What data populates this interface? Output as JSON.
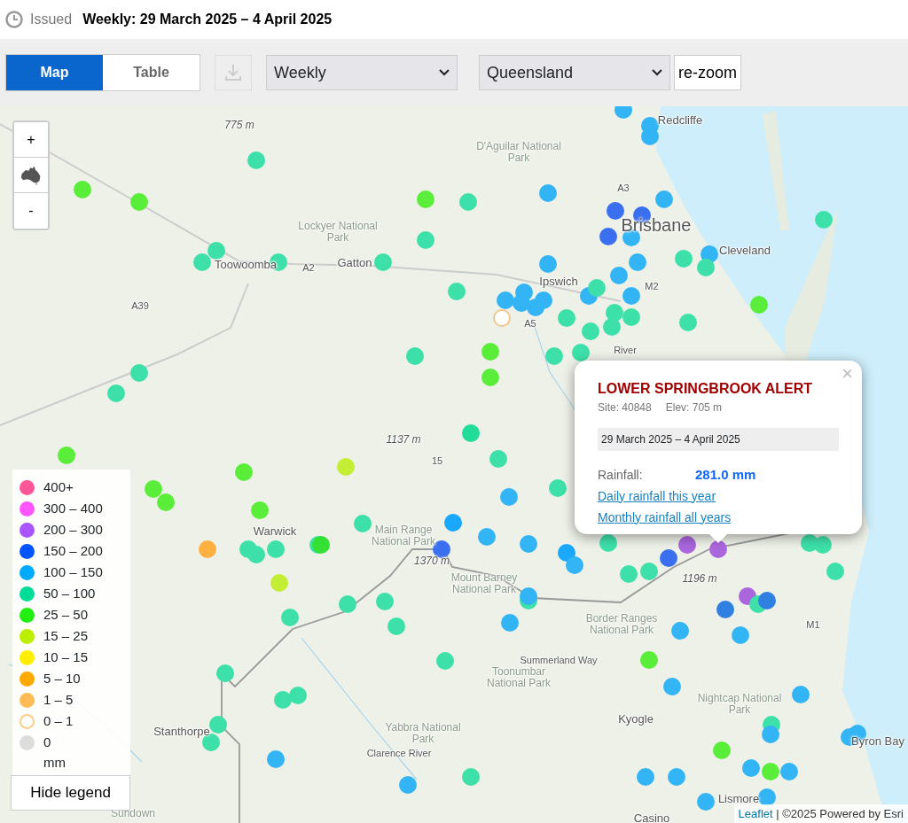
{
  "header": {
    "issued_label": "Issued",
    "title": "Weekly: 29 March 2025 – 4 April 2025"
  },
  "toolbar": {
    "tabs": [
      {
        "label": "Map",
        "selected": true
      },
      {
        "label": "Table",
        "selected": false
      }
    ],
    "download": {
      "disabled": true
    },
    "period_select": {
      "value": "Weekly"
    },
    "region_select": {
      "value": "Queensland"
    },
    "rezoom_button": {
      "label": "re-zoom"
    }
  },
  "map": {
    "zoom_controls": {
      "zoom_in": "+",
      "zoom_out": "-"
    },
    "places": [
      {
        "name": "775 m",
        "kind": "elev"
      },
      {
        "name": "Redcliffe",
        "kind": "town"
      },
      {
        "name": "D'Aguilar National Park",
        "kind": "park"
      },
      {
        "name": "Lockyer National Park",
        "kind": "park"
      },
      {
        "name": "Brisbane",
        "kind": "city"
      },
      {
        "name": "Cleveland",
        "kind": "town"
      },
      {
        "name": "Toowoomba",
        "kind": "town"
      },
      {
        "name": "A2",
        "kind": "road"
      },
      {
        "name": "Gatton",
        "kind": "town"
      },
      {
        "name": "A39",
        "kind": "road"
      },
      {
        "name": "A3",
        "kind": "road"
      },
      {
        "name": "Ipswich",
        "kind": "town"
      },
      {
        "name": "M2",
        "kind": "road"
      },
      {
        "name": "A5",
        "kind": "road"
      },
      {
        "name": "River",
        "kind": "road"
      },
      {
        "name": "1137 m",
        "kind": "elev"
      },
      {
        "name": "15",
        "kind": "road"
      },
      {
        "name": "Warwick",
        "kind": "town"
      },
      {
        "name": "Main Range National Park",
        "kind": "park"
      },
      {
        "name": "1370 m",
        "kind": "elev"
      },
      {
        "name": "Mount Barney National Park",
        "kind": "park"
      },
      {
        "name": "1196 m",
        "kind": "elev"
      },
      {
        "name": "Border Ranges National Park",
        "kind": "park"
      },
      {
        "name": "Summerland Way",
        "kind": "road"
      },
      {
        "name": "Toonumbar National Park",
        "kind": "park"
      },
      {
        "name": "Kyogle",
        "kind": "town"
      },
      {
        "name": "Nightcap National Park",
        "kind": "park"
      },
      {
        "name": "Yabbra National Park",
        "kind": "park"
      },
      {
        "name": "Clarence River",
        "kind": "road"
      },
      {
        "name": "Stanthorpe",
        "kind": "town"
      },
      {
        "name": "M1",
        "kind": "road"
      },
      {
        "name": "Byron Bay",
        "kind": "town"
      },
      {
        "name": "Lismore",
        "kind": "town"
      },
      {
        "name": "Casino",
        "kind": "town"
      },
      {
        "name": "Sundown",
        "kind": "park"
      }
    ],
    "stations": [
      {
        "color": "#33b5f5",
        "kind": "dot"
      },
      {
        "color": "#33b5f5",
        "kind": "dot"
      },
      {
        "color": "#33b5f5",
        "kind": "dot"
      },
      {
        "color": "#3ee0aa",
        "kind": "dot"
      },
      {
        "color": "#5aee3a",
        "kind": "dot"
      },
      {
        "color": "#5aee3a",
        "kind": "dot"
      },
      {
        "color": "#33b5f5",
        "kind": "dot"
      },
      {
        "color": "#3ee0aa",
        "kind": "dot"
      },
      {
        "color": "#5aee3a",
        "kind": "dot"
      },
      {
        "color": "#3a6ff0",
        "kind": "dot"
      },
      {
        "color": "#3a6ff0",
        "kind": "dot"
      },
      {
        "color": "#33b5f5",
        "kind": "dot"
      },
      {
        "color": "#3ee0aa",
        "kind": "dot"
      },
      {
        "color": "#3ee0aa",
        "kind": "dot"
      },
      {
        "color": "#3a6ff0",
        "kind": "dot"
      },
      {
        "color": "#33b5f5",
        "kind": "dot"
      },
      {
        "color": "#3ee0aa",
        "kind": "dot"
      },
      {
        "color": "#3ee0aa",
        "kind": "dot"
      },
      {
        "color": "#3ee0aa",
        "kind": "dot"
      },
      {
        "color": "#3ee0aa",
        "kind": "dot"
      },
      {
        "color": "#3ee0aa",
        "kind": "dot"
      },
      {
        "color": "#33b5f5",
        "kind": "dot"
      },
      {
        "color": "#3ee0aa",
        "kind": "dot"
      },
      {
        "color": "#33b5f5",
        "kind": "dot"
      },
      {
        "color": "#33b5f5",
        "kind": "dot"
      },
      {
        "color": "#33b5f5",
        "kind": "dot"
      },
      {
        "color": "#3ee0aa",
        "kind": "dot"
      },
      {
        "color": "#33b5f5",
        "kind": "dot"
      },
      {
        "color": "#33b5f5",
        "kind": "dot"
      },
      {
        "color": "#33b5f5",
        "kind": "dot"
      },
      {
        "color": "#33b5f5",
        "kind": "dot"
      },
      {
        "color": "#33b5f5",
        "kind": "dot"
      },
      {
        "color": "#33b5f5",
        "kind": "dot"
      },
      {
        "color": "#3ee0aa",
        "kind": "dot"
      },
      {
        "color": "#33b5f5",
        "kind": "dot"
      },
      {
        "color": "#5aee3a",
        "kind": "dot"
      },
      {
        "color": "#f0c890",
        "kind": "ring"
      },
      {
        "color": "#3ee0aa",
        "kind": "dot"
      },
      {
        "color": "#3ee0aa",
        "kind": "dot"
      },
      {
        "color": "#3ee0aa",
        "kind": "dot"
      },
      {
        "color": "#3ee0aa",
        "kind": "dot"
      },
      {
        "color": "#3ee0aa",
        "kind": "dot"
      },
      {
        "color": "#3ee0aa",
        "kind": "dot"
      },
      {
        "color": "#5aee3a",
        "kind": "dot"
      },
      {
        "color": "#3ee0aa",
        "kind": "dot"
      },
      {
        "color": "#3ee0aa",
        "kind": "dot"
      },
      {
        "color": "#3ee0aa",
        "kind": "dot"
      },
      {
        "color": "#3ee0aa",
        "kind": "dot"
      },
      {
        "color": "#5aee3a",
        "kind": "dot"
      },
      {
        "color": "#3ee0aa",
        "kind": "dot"
      },
      {
        "color": "#22dd99",
        "kind": "dot"
      },
      {
        "color": "#c4ee33",
        "kind": "dot"
      },
      {
        "color": "#5aee3a",
        "kind": "dot"
      },
      {
        "color": "#5aee3a",
        "kind": "dot"
      },
      {
        "color": "#3ee0aa",
        "kind": "dot"
      },
      {
        "color": "#3ee0aa",
        "kind": "dot"
      },
      {
        "color": "#5aee3a",
        "kind": "dot"
      },
      {
        "color": "#5aee3a",
        "kind": "dot"
      },
      {
        "color": "#5aee3a",
        "kind": "dot"
      },
      {
        "color": "#33b5f5",
        "kind": "dot"
      },
      {
        "color": "#ffb040",
        "kind": "dot"
      },
      {
        "color": "#3ee0aa",
        "kind": "dot"
      },
      {
        "color": "#3ee0aa",
        "kind": "dot"
      },
      {
        "color": "#3ee0aa",
        "kind": "dot"
      },
      {
        "color": "#3ee0aa",
        "kind": "dot"
      },
      {
        "color": "#33e033",
        "kind": "dot"
      },
      {
        "color": "#3ee0aa",
        "kind": "dot"
      },
      {
        "color": "#1aa8ff",
        "kind": "dot"
      },
      {
        "color": "#33b5f5",
        "kind": "dot"
      },
      {
        "color": "#33b5f5",
        "kind": "dot"
      },
      {
        "color": "#3a6ff0",
        "kind": "dot"
      },
      {
        "color": "#1aa8ff",
        "kind": "dot"
      },
      {
        "color": "#33b5f5",
        "kind": "dot"
      },
      {
        "color": "#c4ee33",
        "kind": "dot"
      },
      {
        "color": "#3ee0aa",
        "kind": "dot"
      },
      {
        "color": "#3ee0aa",
        "kind": "dot"
      },
      {
        "color": "#3ee0aa",
        "kind": "dot"
      },
      {
        "color": "#3ee0aa",
        "kind": "dot"
      },
      {
        "color": "#3ee0aa",
        "kind": "dot"
      },
      {
        "color": "#3ee0aa",
        "kind": "dot"
      },
      {
        "color": "#3ee0aa",
        "kind": "dot"
      },
      {
        "color": "#aa66dd",
        "kind": "dot"
      },
      {
        "color": "#aa66dd",
        "kind": "dot"
      },
      {
        "color": "#3a6ff0",
        "kind": "dot"
      },
      {
        "color": "#3ee0aa",
        "kind": "dot"
      },
      {
        "color": "#3ee0aa",
        "kind": "dot"
      },
      {
        "color": "#3ee0aa",
        "kind": "dot"
      },
      {
        "color": "#3ee0aa",
        "kind": "dot"
      },
      {
        "color": "#33b5f5",
        "kind": "dot"
      },
      {
        "color": "#33b5f5",
        "kind": "dot"
      },
      {
        "color": "#33b5f5",
        "kind": "dot"
      },
      {
        "color": "#2f80e0",
        "kind": "dot"
      },
      {
        "color": "#aa66dd",
        "kind": "dot"
      },
      {
        "color": "#3ee0aa",
        "kind": "dot"
      },
      {
        "color": "#2f80e0",
        "kind": "dot"
      },
      {
        "color": "#33b5f5",
        "kind": "dot"
      },
      {
        "color": "#3ee0aa",
        "kind": "dot"
      },
      {
        "color": "#3ee0aa",
        "kind": "dot"
      },
      {
        "color": "#5aee3a",
        "kind": "dot"
      },
      {
        "color": "#33b5f5",
        "kind": "dot"
      },
      {
        "color": "#33b5f5",
        "kind": "dot"
      },
      {
        "color": "#3ee0aa",
        "kind": "dot"
      },
      {
        "color": "#3ee0aa",
        "kind": "dot"
      },
      {
        "color": "#3ee0aa",
        "kind": "dot"
      },
      {
        "color": "#3ee0aa",
        "kind": "dot"
      },
      {
        "color": "#3ee0aa",
        "kind": "dot"
      },
      {
        "color": "#33b5f5",
        "kind": "dot"
      },
      {
        "color": "#33b5f5",
        "kind": "dot"
      },
      {
        "color": "#33b5f5",
        "kind": "dot"
      },
      {
        "color": "#5aee3a",
        "kind": "dot"
      },
      {
        "color": "#33b5f5",
        "kind": "dot"
      },
      {
        "color": "#33b5f5",
        "kind": "dot"
      },
      {
        "color": "#5aee3a",
        "kind": "dot"
      },
      {
        "color": "#33b5f5",
        "kind": "dot"
      },
      {
        "color": "#33b5f5",
        "kind": "dot"
      },
      {
        "color": "#33b5f5",
        "kind": "dot"
      },
      {
        "color": "#3ee0aa",
        "kind": "dot"
      },
      {
        "color": "#33b5f5",
        "kind": "dot"
      },
      {
        "color": "#33b5f5",
        "kind": "dot"
      },
      {
        "color": "#33b5f5",
        "kind": "dot"
      }
    ],
    "popup": {
      "title": "LOWER SPRINGBROOK ALERT",
      "site": "Site: 40848",
      "elevation": "Elev: 705 m",
      "period": "29 March 2025 – 4 April 2025",
      "rainfall_label": "Rainfall:",
      "rainfall_value": "281.0 mm",
      "links": [
        "Daily rainfall this year",
        "Monthly rainfall all years"
      ],
      "close": "×"
    },
    "legend": {
      "items": [
        {
          "label": "400+",
          "color": "#ff5599",
          "kind": "dot"
        },
        {
          "label": "300 – 400",
          "color": "#ff55ff",
          "kind": "dot"
        },
        {
          "label": "200 – 300",
          "color": "#aa55ff",
          "kind": "dot"
        },
        {
          "label": "150 – 200",
          "color": "#0055ff",
          "kind": "dot"
        },
        {
          "label": "100 – 150",
          "color": "#00aaff",
          "kind": "dot"
        },
        {
          "label": "50 – 100",
          "color": "#00dd99",
          "kind": "dot"
        },
        {
          "label": "25 – 50",
          "color": "#22ee11",
          "kind": "dot"
        },
        {
          "label": "15 – 25",
          "color": "#bbee00",
          "kind": "dot"
        },
        {
          "label": "10 – 15",
          "color": "#ffee00",
          "kind": "dot"
        },
        {
          "label": "5 – 10",
          "color": "#ffaa00",
          "kind": "dot"
        },
        {
          "label": "1 – 5",
          "color": "#ffbb55",
          "kind": "dot"
        },
        {
          "label": "0 – 1",
          "color": "#ffcc88",
          "kind": "ring"
        },
        {
          "label": "0",
          "color": "#dddddd",
          "kind": "dot"
        }
      ],
      "unit": "mm",
      "toggle": "Hide legend"
    },
    "attribution": {
      "link": "Leaflet",
      "text": "| ©2025 Powered by Esri"
    }
  }
}
